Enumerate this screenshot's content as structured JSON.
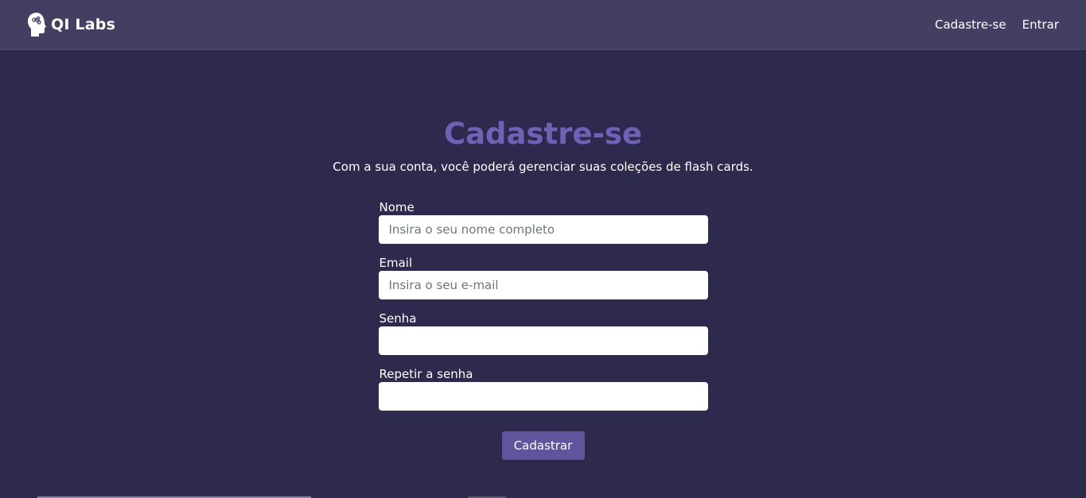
{
  "navbar": {
    "brand_name": "QI Labs",
    "brand_icon": "brain-head-icon",
    "links": [
      {
        "label": "Cadastre-se"
      },
      {
        "label": "Entrar"
      }
    ]
  },
  "main": {
    "title": "Cadastre-se",
    "subtitle": "Com a sua conta, você poderá gerenciar suas coleções de flash cards.",
    "form": {
      "fields": [
        {
          "label": "Nome",
          "placeholder": "Insira o seu nome completo",
          "value": ""
        },
        {
          "label": "Email",
          "placeholder": "Insira o seu e-mail",
          "value": ""
        },
        {
          "label": "Senha",
          "placeholder": "",
          "value": ""
        },
        {
          "label": "Repetir a senha",
          "placeholder": "",
          "value": ""
        }
      ],
      "submit_label": "Cadastrar"
    }
  },
  "colors": {
    "background": "#2e2a4e",
    "navbar": "#433f62",
    "title": "#6f62b6",
    "button": "#5f559c"
  }
}
